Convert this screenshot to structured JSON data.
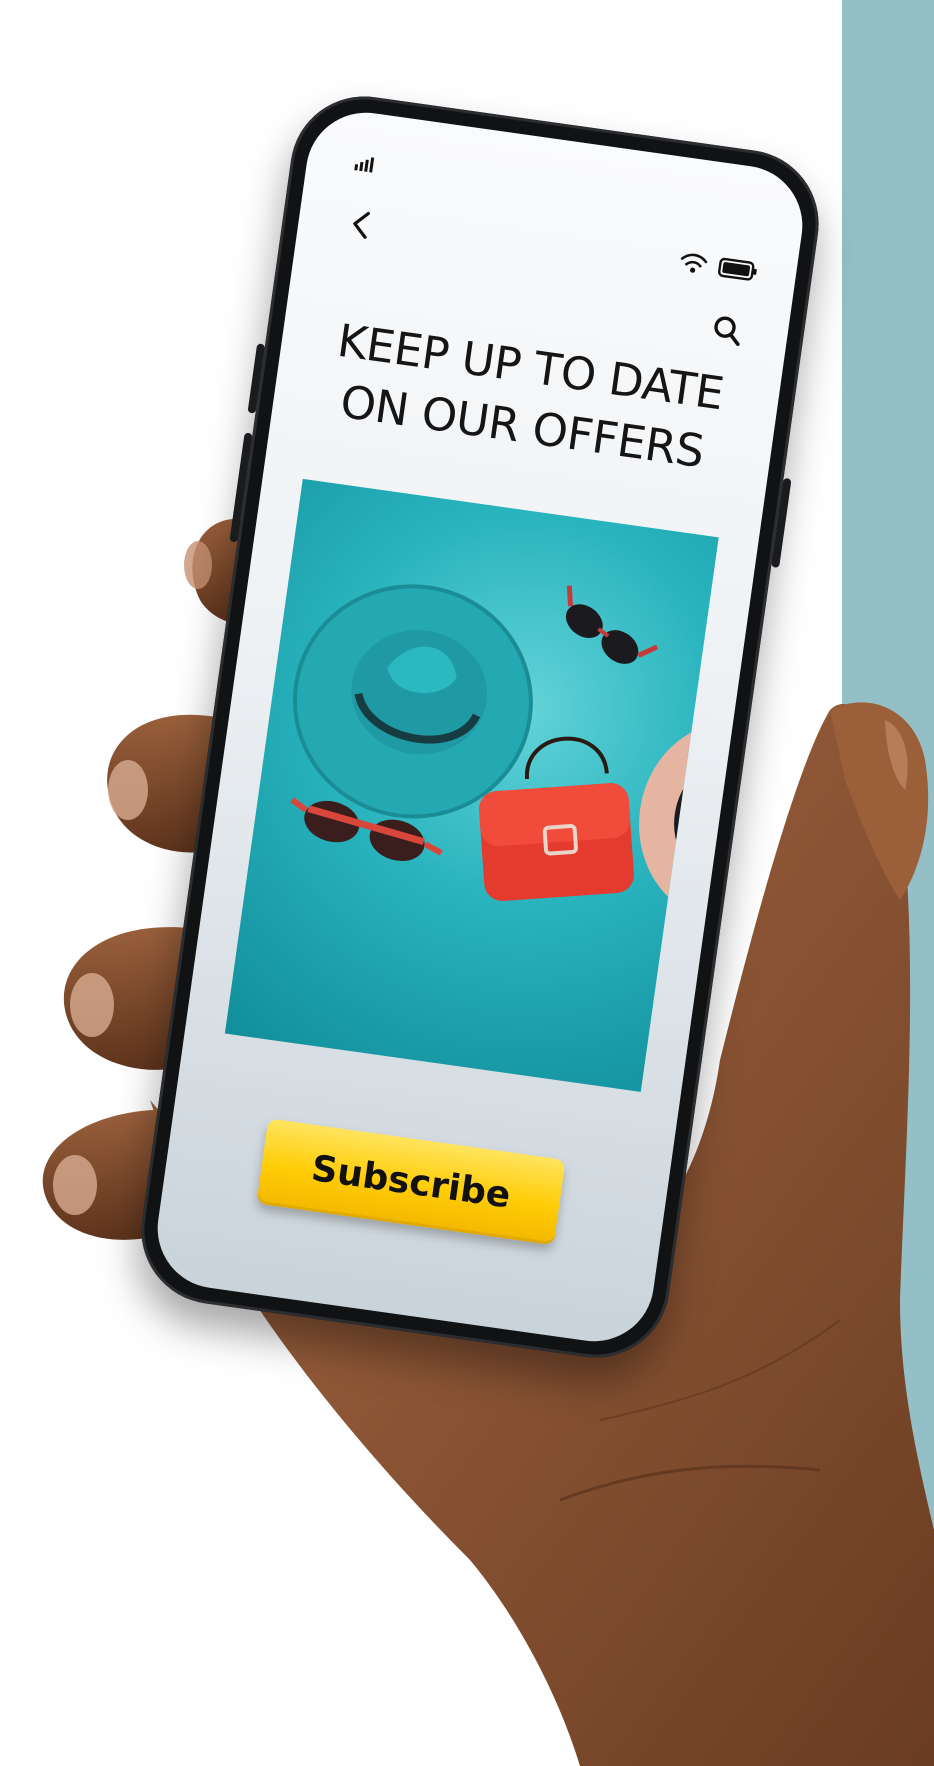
{
  "screen": {
    "title": "KEEP UP TO DATE\nON  OUR OFFERS",
    "subscribe_label": "Subscribe"
  },
  "icons": {
    "signal": "signal-bars-icon",
    "back": "back-chevron-icon",
    "wifi": "wifi-icon",
    "battery": "battery-icon",
    "search": "search-icon"
  },
  "promo_image": {
    "items": [
      "teal-fedora-hat",
      "red-sunglasses",
      "red-sunglasses",
      "red-handbag",
      "straw-hat"
    ],
    "background": "#2ab3bd"
  },
  "colors": {
    "accent_button": "#ffcc06",
    "background_strip": "#94bfc6",
    "screen_bg": "#eef1f4"
  }
}
